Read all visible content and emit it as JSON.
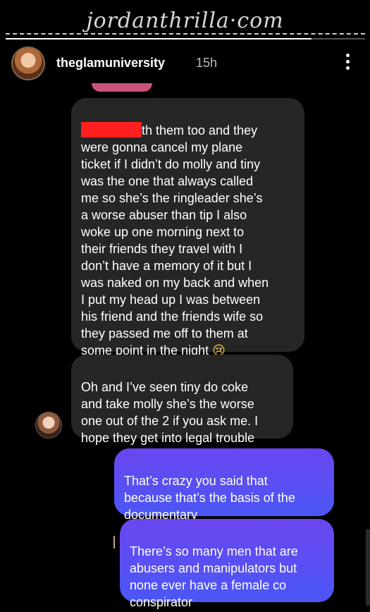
{
  "watermark": "jordanthrilla·com",
  "story": {
    "progress": 0.85
  },
  "header": {
    "username": "theglamuniversity",
    "time": "15h",
    "more_icon": "more-vertical-icon"
  },
  "messages": {
    "incoming_1_after_redaction": "th them too and they\nwere gonna cancel my plane\nticket if I didn’t do molly and tiny\nwas the one that always called\nme so she’s the ringleader she’s\na worse abuser than tip I also\nwoke up one morning next to\ntheir friends they travel with I\ndon’t have a memory of it but I\nwas naked on my back and when\nI put my head up I was between\nhis friend and the friends wife so\nthey passed me off to them at\nsome point in the night ",
    "incoming_1_emoji": "😢",
    "incoming_2": "Oh and I’ve seen tiny do coke\nand take molly she’s the worse\none out of the 2 if you ask me. I\nhope they get into legal trouble",
    "outgoing_1": "That’s crazy you said that\nbecause that’s the basis of the\ndocumentary",
    "outgoing_2": "There’s so many men that are\nabusers and manipulators but\nnone ever have a female co\nconspirator"
  },
  "colors": {
    "incoming_bubble": "#262626",
    "outgoing_top": "#6b46f0",
    "outgoing_bottom": "#4a57f5",
    "redaction": "#ff1f1f"
  }
}
